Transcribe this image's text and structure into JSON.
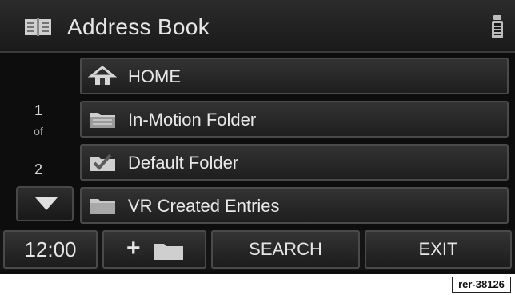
{
  "header": {
    "title": "Address Book",
    "icon": "address-book-icon",
    "status_icon": "phone-status-icon"
  },
  "pager": {
    "current": "1",
    "of": "of",
    "total": "2",
    "down_icon": "down-arrow-icon"
  },
  "list": {
    "items": [
      {
        "label": "HOME",
        "icon": "home-icon"
      },
      {
        "label": "In-Motion Folder",
        "icon": "folder-icon"
      },
      {
        "label": "Default Folder",
        "icon": "checked-folder-icon"
      },
      {
        "label": "VR Created Entries",
        "icon": "folder-icon"
      }
    ]
  },
  "bottom_bar": {
    "clock": "12:00",
    "add_folder_plus": "+",
    "search_label": "SEARCH",
    "exit_label": "EXIT"
  },
  "reference_tag": "rer-38126",
  "colors": {
    "background": "#0d0d0d",
    "button": "#2a2a2a",
    "text": "#e6e6e6"
  }
}
